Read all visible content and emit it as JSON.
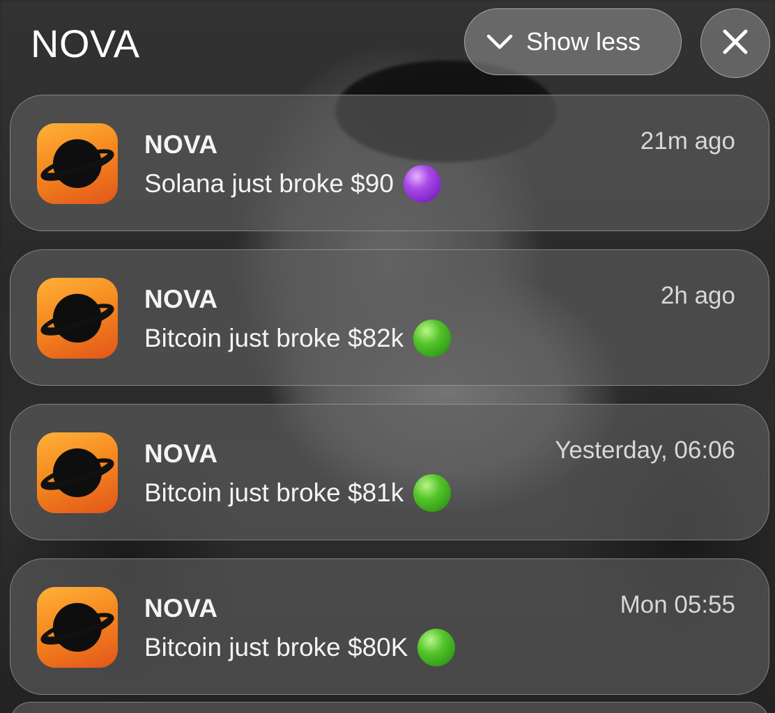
{
  "header": {
    "title": "NOVA",
    "show_less_label": "Show less"
  },
  "notifications": [
    {
      "app": "NOVA",
      "message": "Solana just broke $90",
      "time": "21m ago",
      "dot_color": "#a94ae6"
    },
    {
      "app": "NOVA",
      "message": "Bitcoin just broke $82k",
      "time": "2h ago",
      "dot_color": "#55c42a"
    },
    {
      "app": "NOVA",
      "message": "Bitcoin just broke $81k",
      "time": "Yesterday, 06:06",
      "dot_color": "#55c42a"
    },
    {
      "app": "NOVA",
      "message": "Bitcoin just broke $80K",
      "time": "Mon 05:55",
      "dot_color": "#55c42a"
    }
  ],
  "colors": {
    "app_icon_orange": "#f58a1f",
    "card_background": "#5f5f5f"
  },
  "icons": {
    "show_less": "chevron-down-icon",
    "close": "close-icon",
    "app": "planet-icon"
  }
}
